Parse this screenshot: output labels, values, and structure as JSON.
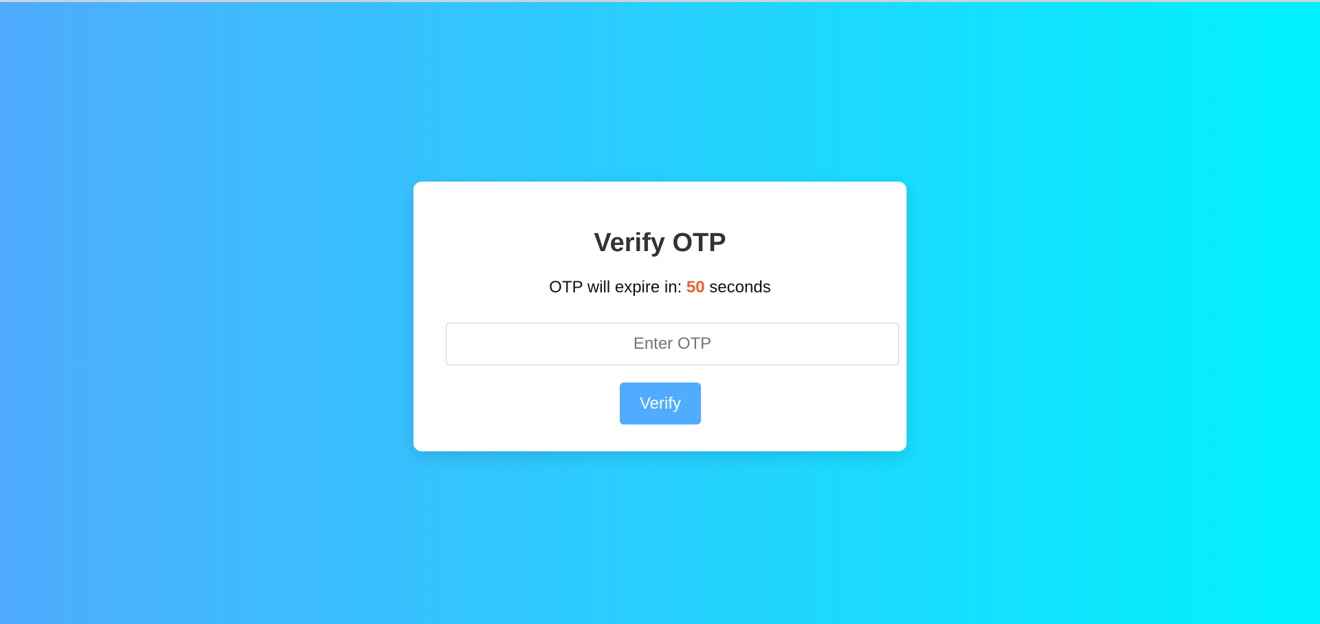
{
  "colors": {
    "gradient_start": "#4facfe",
    "gradient_end": "#00f2fe",
    "card_background": "#ffffff",
    "countdown_accent": "#f0612d",
    "button_background": "#4facfe"
  },
  "card": {
    "title": "Verify OTP",
    "timer": {
      "prefix": "OTP will expire in:",
      "seconds": "50",
      "suffix": "seconds"
    },
    "otp_input": {
      "value": "",
      "placeholder": "Enter OTP"
    },
    "verify_button": {
      "label": "Verify"
    }
  }
}
